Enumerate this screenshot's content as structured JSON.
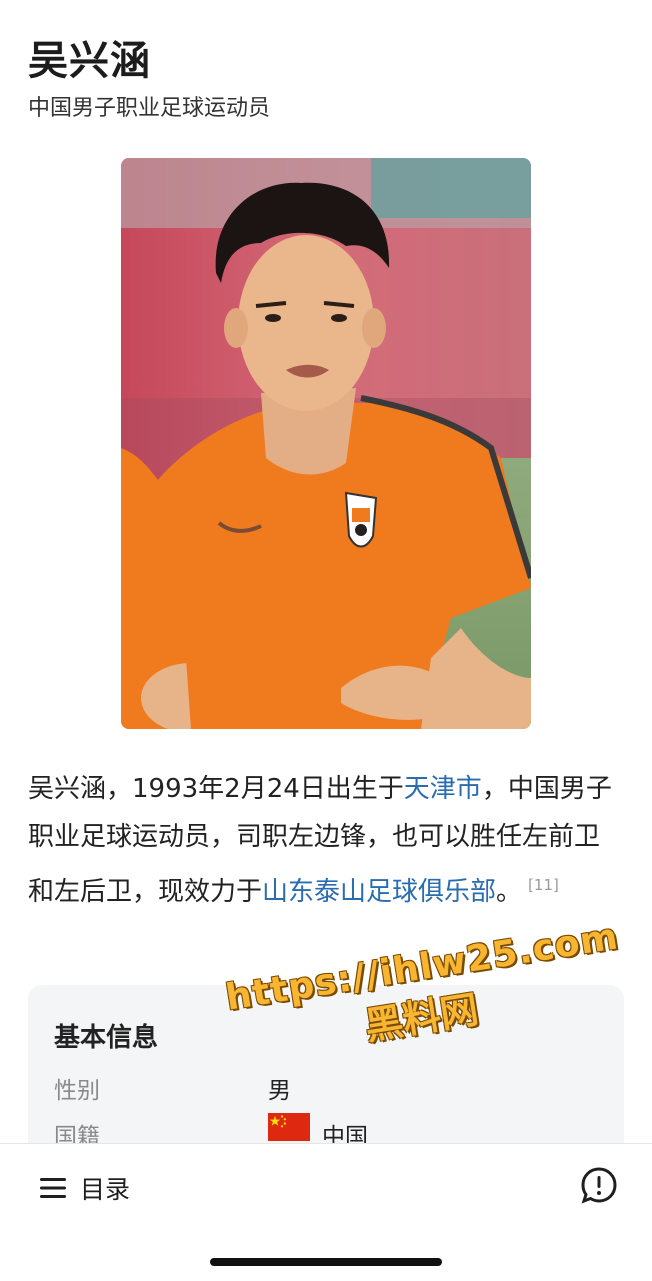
{
  "header": {
    "title": "吴兴涵",
    "subtitle": "中国男子职业足球运动员"
  },
  "bio": {
    "text_1": "吴兴涵，1993年2月24日出生于",
    "link_city": "天津市",
    "text_2": "，中国男子职业足球运动员，司职左边锋，也可以胜任左前卫和左后卫，现效力于",
    "link_club": "山东泰山足球俱乐部",
    "text_3": "。",
    "citation": "[11]"
  },
  "infobox": {
    "title": "基本信息",
    "rows": [
      {
        "label": "性别",
        "value": "男"
      },
      {
        "label": "国籍",
        "value": "中国"
      }
    ]
  },
  "watermark": {
    "url": "https://ihlw25.com",
    "name": "黑料网"
  },
  "bottom_bar": {
    "toc_label": "目录"
  },
  "colors": {
    "link": "#2a6cb0",
    "jersey": "#f07a1e",
    "watermark": "#f7b532"
  }
}
